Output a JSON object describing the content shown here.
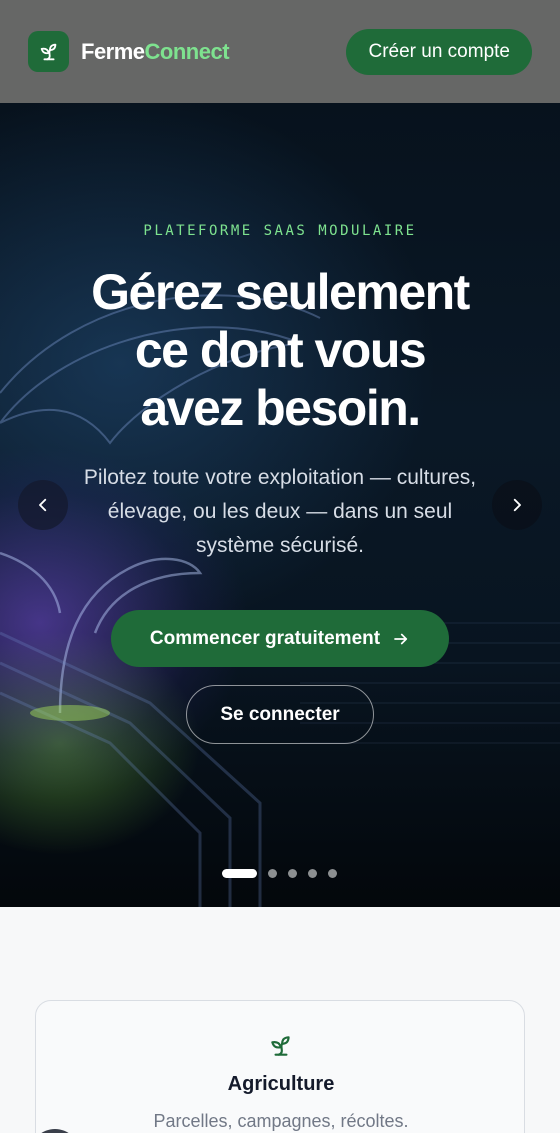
{
  "header": {
    "brand_part1": "Ferme",
    "brand_part2": "Connect",
    "logo_icon": "sprout-icon",
    "cta_label": "Créer un compte"
  },
  "hero": {
    "eyebrow": "PLATEFORME SAAS MODULAIRE",
    "headline_lines": [
      "Gérez seulement",
      "ce dont vous",
      "avez besoin."
    ],
    "subtitle_lines": [
      "Pilotez toute votre exploitation — cultures,",
      "élevage, ou les deux — dans un seul",
      "système sécurisé."
    ],
    "primary_button": "Commencer gratuitement",
    "primary_button_icon": "arrow-right-icon",
    "secondary_button": "Se connecter",
    "prev_icon": "chevron-left-icon",
    "next_icon": "chevron-right-icon",
    "slide_count": 5,
    "active_slide": 1
  },
  "cards": [
    {
      "icon": "sprout-icon",
      "title": "Agriculture",
      "description": "Parcelles, campagnes, récoltes."
    }
  ],
  "colors": {
    "brand_green": "#1f6b39",
    "accent_green": "#7ee28f",
    "header_bg": "#666766",
    "page_bg": "#f7f8f9"
  }
}
